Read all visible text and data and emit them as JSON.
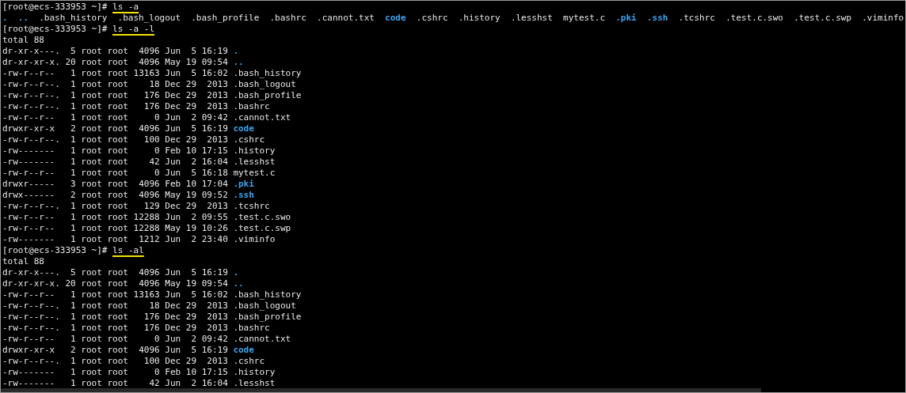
{
  "lines": [
    {
      "kind": "prompt",
      "prompt": "[root@ecs-333953 ~]#",
      "command": "ls -a",
      "highlighted": true
    },
    {
      "kind": "names",
      "entries": [
        {
          "name": ".",
          "is_dir": true
        },
        {
          "name": "..",
          "is_dir": true
        },
        {
          "name": ".bash_history",
          "is_dir": false
        },
        {
          "name": ".bash_logout",
          "is_dir": false
        },
        {
          "name": ".bash_profile",
          "is_dir": false
        },
        {
          "name": ".bashrc",
          "is_dir": false
        },
        {
          "name": ".cannot.txt",
          "is_dir": false
        },
        {
          "name": "code",
          "is_dir": true
        },
        {
          "name": ".cshrc",
          "is_dir": false
        },
        {
          "name": ".history",
          "is_dir": false
        },
        {
          "name": ".lesshst",
          "is_dir": false
        },
        {
          "name": "mytest.c",
          "is_dir": false
        },
        {
          "name": ".pki",
          "is_dir": true
        },
        {
          "name": ".ssh",
          "is_dir": true
        },
        {
          "name": ".tcshrc",
          "is_dir": false
        },
        {
          "name": ".test.c.swo",
          "is_dir": false
        },
        {
          "name": ".test.c.swp",
          "is_dir": false
        },
        {
          "name": ".viminfo",
          "is_dir": false
        }
      ]
    },
    {
      "kind": "prompt",
      "prompt": "[root@ecs-333953 ~]#",
      "command": "ls -a -l",
      "highlighted": true
    },
    {
      "kind": "text",
      "text": "total 88"
    },
    {
      "kind": "entry",
      "meta": "dr-xr-x---.  5 root root  4096 Jun  5 16:19",
      "name": ".",
      "is_dir": true
    },
    {
      "kind": "entry",
      "meta": "dr-xr-xr-x. 20 root root  4096 May 19 09:54",
      "name": "..",
      "is_dir": true
    },
    {
      "kind": "entry",
      "meta": "-rw-r--r--   1 root root 13163 Jun  5 16:02",
      "name": ".bash_history",
      "is_dir": false
    },
    {
      "kind": "entry",
      "meta": "-rw-r--r--.  1 root root    18 Dec 29  2013",
      "name": ".bash_logout",
      "is_dir": false
    },
    {
      "kind": "entry",
      "meta": "-rw-r--r--.  1 root root   176 Dec 29  2013",
      "name": ".bash_profile",
      "is_dir": false
    },
    {
      "kind": "entry",
      "meta": "-rw-r--r--.  1 root root   176 Dec 29  2013",
      "name": ".bashrc",
      "is_dir": false
    },
    {
      "kind": "entry",
      "meta": "-rw-r--r--   1 root root     0 Jun  2 09:42",
      "name": ".cannot.txt",
      "is_dir": false
    },
    {
      "kind": "entry",
      "meta": "drwxr-xr-x   2 root root  4096 Jun  5 16:19",
      "name": "code",
      "is_dir": true
    },
    {
      "kind": "entry",
      "meta": "-rw-r--r--.  1 root root   100 Dec 29  2013",
      "name": ".cshrc",
      "is_dir": false
    },
    {
      "kind": "entry",
      "meta": "-rw-------   1 root root     0 Feb 10 17:15",
      "name": ".history",
      "is_dir": false
    },
    {
      "kind": "entry",
      "meta": "-rw-------   1 root root    42 Jun  2 16:04",
      "name": ".lesshst",
      "is_dir": false
    },
    {
      "kind": "entry",
      "meta": "-rw-r--r--   1 root root     0 Jun  5 16:18",
      "name": "mytest.c",
      "is_dir": false
    },
    {
      "kind": "entry",
      "meta": "drwxr-----   3 root root  4096 Feb 10 17:04",
      "name": ".pki",
      "is_dir": true
    },
    {
      "kind": "entry",
      "meta": "drwx------   2 root root  4096 May 19 09:52",
      "name": ".ssh",
      "is_dir": true
    },
    {
      "kind": "entry",
      "meta": "-rw-r--r--.  1 root root   129 Dec 29  2013",
      "name": ".tcshrc",
      "is_dir": false
    },
    {
      "kind": "entry",
      "meta": "-rw-r--r--   1 root root 12288 Jun  2 09:55",
      "name": ".test.c.swo",
      "is_dir": false
    },
    {
      "kind": "entry",
      "meta": "-rw-r--r--   1 root root 12288 May 19 10:26",
      "name": ".test.c.swp",
      "is_dir": false
    },
    {
      "kind": "entry",
      "meta": "-rw-------   1 root root  1212 Jun  2 23:40",
      "name": ".viminfo",
      "is_dir": false
    },
    {
      "kind": "prompt",
      "prompt": "[root@ecs-333953 ~]#",
      "command": "ls -al",
      "highlighted": true
    },
    {
      "kind": "text",
      "text": "total 88"
    },
    {
      "kind": "entry",
      "meta": "dr-xr-x---.  5 root root  4096 Jun  5 16:19",
      "name": ".",
      "is_dir": true
    },
    {
      "kind": "entry",
      "meta": "dr-xr-xr-x. 20 root root  4096 May 19 09:54",
      "name": "..",
      "is_dir": true
    },
    {
      "kind": "entry",
      "meta": "-rw-r--r--   1 root root 13163 Jun  5 16:02",
      "name": ".bash_history",
      "is_dir": false
    },
    {
      "kind": "entry",
      "meta": "-rw-r--r--.  1 root root    18 Dec 29  2013",
      "name": ".bash_logout",
      "is_dir": false
    },
    {
      "kind": "entry",
      "meta": "-rw-r--r--.  1 root root   176 Dec 29  2013",
      "name": ".bash_profile",
      "is_dir": false
    },
    {
      "kind": "entry",
      "meta": "-rw-r--r--.  1 root root   176 Dec 29  2013",
      "name": ".bashrc",
      "is_dir": false
    },
    {
      "kind": "entry",
      "meta": "-rw-r--r--   1 root root     0 Jun  2 09:42",
      "name": ".cannot.txt",
      "is_dir": false
    },
    {
      "kind": "entry",
      "meta": "drwxr-xr-x   2 root root  4096 Jun  5 16:19",
      "name": "code",
      "is_dir": true
    },
    {
      "kind": "entry",
      "meta": "-rw-r--r--.  1 root root   100 Dec 29  2013",
      "name": ".cshrc",
      "is_dir": false
    },
    {
      "kind": "entry",
      "meta": "-rw-------   1 root root     0 Feb 10 17:15",
      "name": ".history",
      "is_dir": false
    },
    {
      "kind": "entry",
      "meta": "-rw-------   1 root root    42 Jun  2 16:04",
      "name": ".lesshst",
      "is_dir": false
    }
  ]
}
